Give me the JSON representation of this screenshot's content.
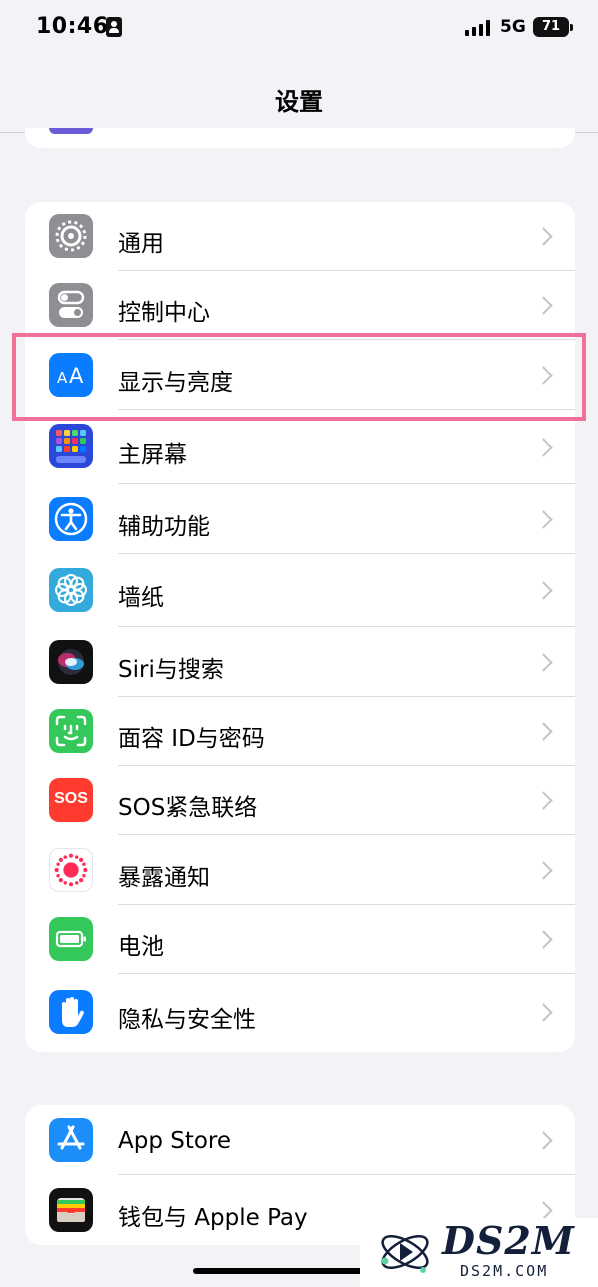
{
  "status_bar": {
    "time": "10:46",
    "network": "5G",
    "battery": "71"
  },
  "nav": {
    "title": "设置"
  },
  "groups": [
    {
      "items": [
        {
          "label": "通用",
          "icon": "gear-icon",
          "color": "#8e8e93"
        },
        {
          "label": "控制中心",
          "icon": "toggles-icon",
          "color": "#8e8e93"
        },
        {
          "label": "显示与亮度",
          "icon": "aa-text-icon",
          "color": "#0a7cff",
          "highlighted": true
        },
        {
          "label": "主屏幕",
          "icon": "home-grid-icon",
          "color": "#2c48d8"
        },
        {
          "label": "辅助功能",
          "icon": "accessibility-icon",
          "color": "#0a7cff"
        },
        {
          "label": "墙纸",
          "icon": "flower-icon",
          "color": "#34aadc"
        },
        {
          "label": "Siri与搜索",
          "icon": "siri-icon",
          "color": "#111111"
        },
        {
          "label": "面容 ID与密码",
          "icon": "face-id-icon",
          "color": "#34c759"
        },
        {
          "label": "SOS紧急联络",
          "icon": "sos-icon",
          "color": "#ff3b30"
        },
        {
          "label": "暴露通知",
          "icon": "exposure-icon",
          "color": "#ffffff"
        },
        {
          "label": "电池",
          "icon": "battery-icon",
          "color": "#34c759"
        },
        {
          "label": "隐私与安全性",
          "icon": "hand-icon",
          "color": "#0a7cff"
        }
      ]
    },
    {
      "items": [
        {
          "label": "App Store",
          "icon": "app-store-icon",
          "color": "#1c8ef9"
        },
        {
          "label": "钱包与 Apple Pay",
          "icon": "wallet-icon",
          "color": "#111111"
        }
      ]
    }
  ],
  "sos_icon_text": "SOS",
  "watermark": {
    "title": "DS2M",
    "subtitle": "DS2M.COM"
  }
}
